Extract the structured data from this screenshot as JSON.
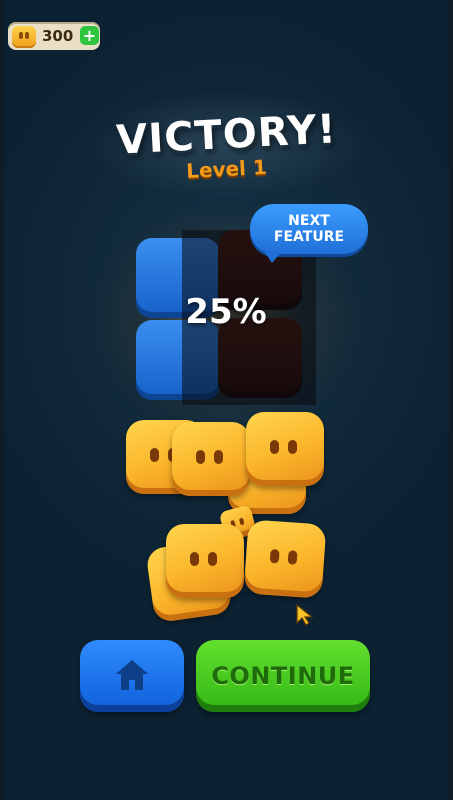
{
  "hud": {
    "coins": "300",
    "plus": "+"
  },
  "result": {
    "title": "VICTORY!",
    "level": "Level 1"
  },
  "feature": {
    "progress_label": "25%",
    "progress_fraction": 0.25,
    "badge": "NEXT\nFEATURE"
  },
  "buttons": {
    "home_icon": "home-icon",
    "continue": "CONTINUE"
  },
  "colors": {
    "accent_orange": "#f29a1a",
    "button_blue": "#1f6fd6",
    "button_green": "#32b615",
    "coin_gold": "#fbb52a"
  }
}
